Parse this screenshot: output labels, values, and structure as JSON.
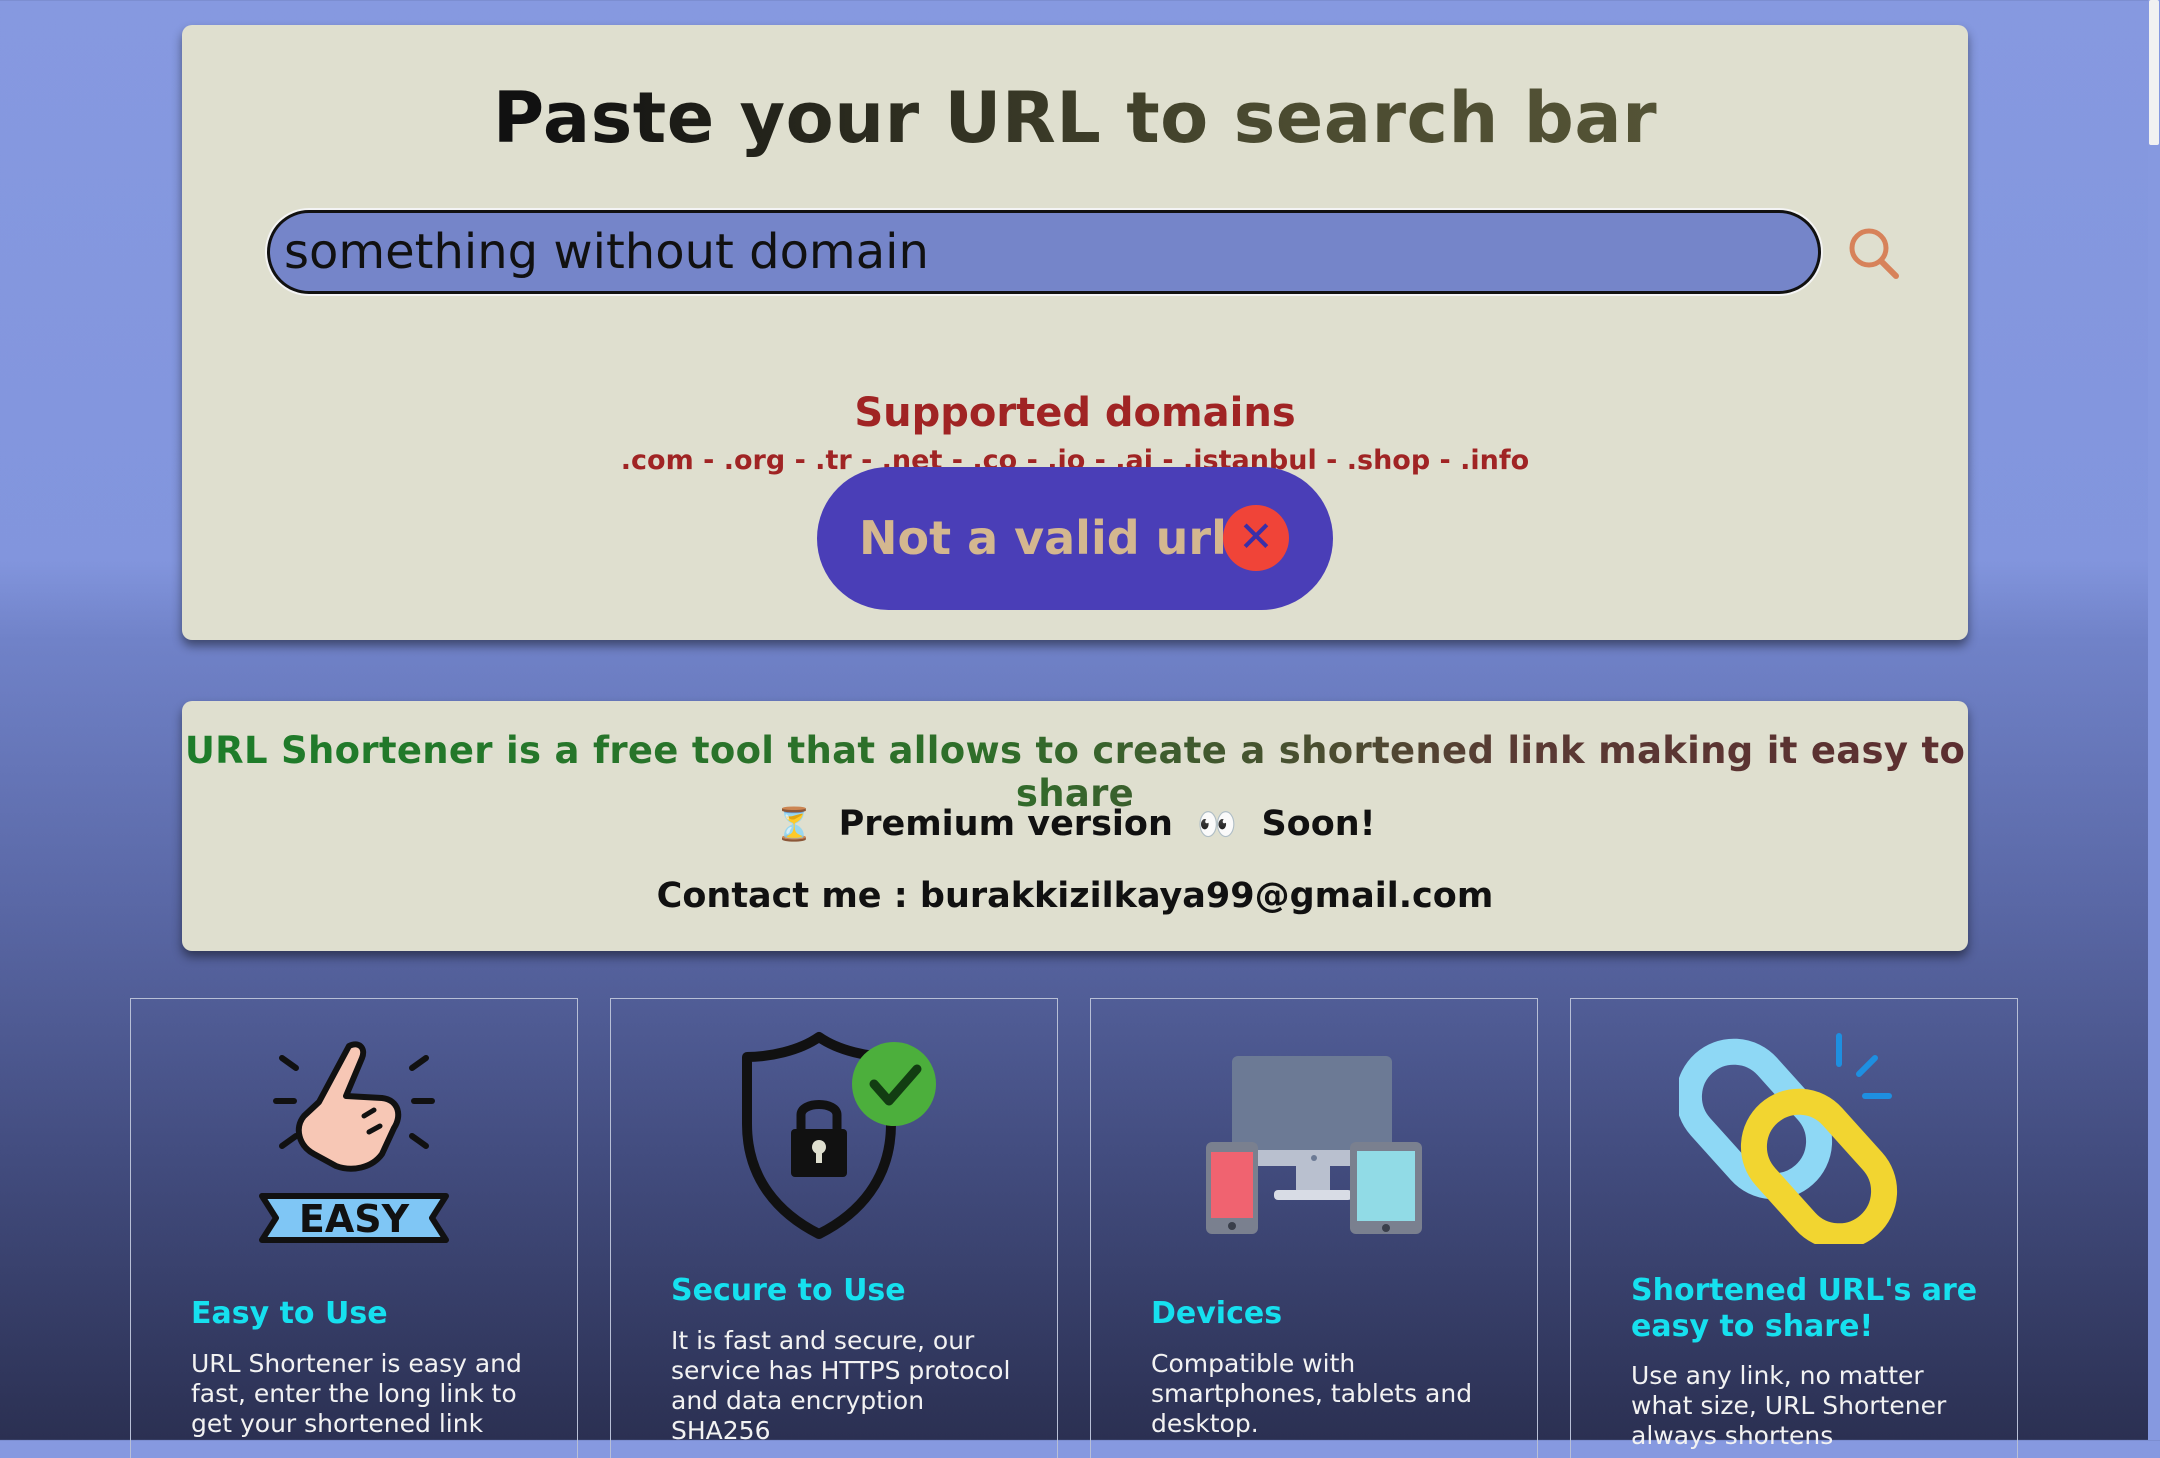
{
  "hero": {
    "title": "Paste your URL to search bar",
    "search_value": "something without domain",
    "search_icon": "search-icon",
    "domains_title": "Supported domains",
    "domains_list": ".com - .org - .tr - .net - .co - .io - .ai - .istanbul - .shop - .info",
    "error_message": "Not a valid url.",
    "error_close_icon": "close-icon"
  },
  "info": {
    "tagline": "URL Shortener is a free tool that allows to create a shortened link making it easy to share",
    "hourglass_emoji": "⏳",
    "premium_label": "Premium version",
    "eyes_emoji": "👀",
    "soon_label": "Soon!",
    "contact": "Contact me : burakkizilkaya99@gmail.com"
  },
  "features": [
    {
      "icon": "easy-click-icon",
      "badge": "EASY",
      "title": "Easy to Use",
      "description": "URL Shortener is easy and fast, enter the long link to get your shortened link"
    },
    {
      "icon": "shield-lock-icon",
      "title": "Secure to Use",
      "description": "It is fast and secure, our service has HTTPS protocol and data encryption SHA256"
    },
    {
      "icon": "devices-icon",
      "title": "Devices",
      "description": "Compatible with smartphones, tablets and desktop."
    },
    {
      "icon": "chain-link-icon",
      "title": "Shortened URL's are easy to share!",
      "description": "Use any link, no matter what size, URL Shortener always shortens"
    }
  ],
  "colors": {
    "card_bg": "#dfdfcf",
    "input_bg": "#7585c9",
    "error_pill": "#4a3eb7",
    "error_close": "#f04438",
    "domains_red": "#a02424",
    "feature_title": "#16e0ef"
  }
}
